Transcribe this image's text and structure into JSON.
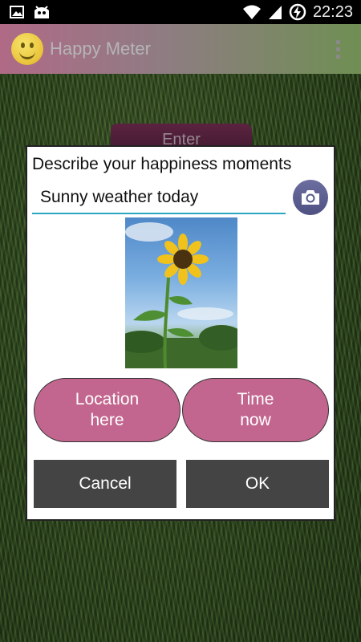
{
  "status_bar": {
    "time": "22:23",
    "icons": [
      "image-icon",
      "android-icon",
      "wifi-icon",
      "signal-icon",
      "battery-charging-icon"
    ]
  },
  "action_bar": {
    "title": "Happy Meter",
    "app_icon": "smiley-icon",
    "overflow_icon": "overflow-menu-icon"
  },
  "background": {
    "enter_label": "Enter"
  },
  "dialog": {
    "title": "Describe your happiness moments",
    "input_value": "Sunny weather today",
    "camera_icon": "camera-icon",
    "photo": "sunflower-photo",
    "location_button": "Location\nhere",
    "time_button": "Time\nnow",
    "cancel_label": "Cancel",
    "ok_label": "OK"
  },
  "colors": {
    "pill": "#c3668f",
    "dialog_button": "#444444",
    "input_underline": "#2aa6c4",
    "camera_button": "#5a5b8c"
  }
}
